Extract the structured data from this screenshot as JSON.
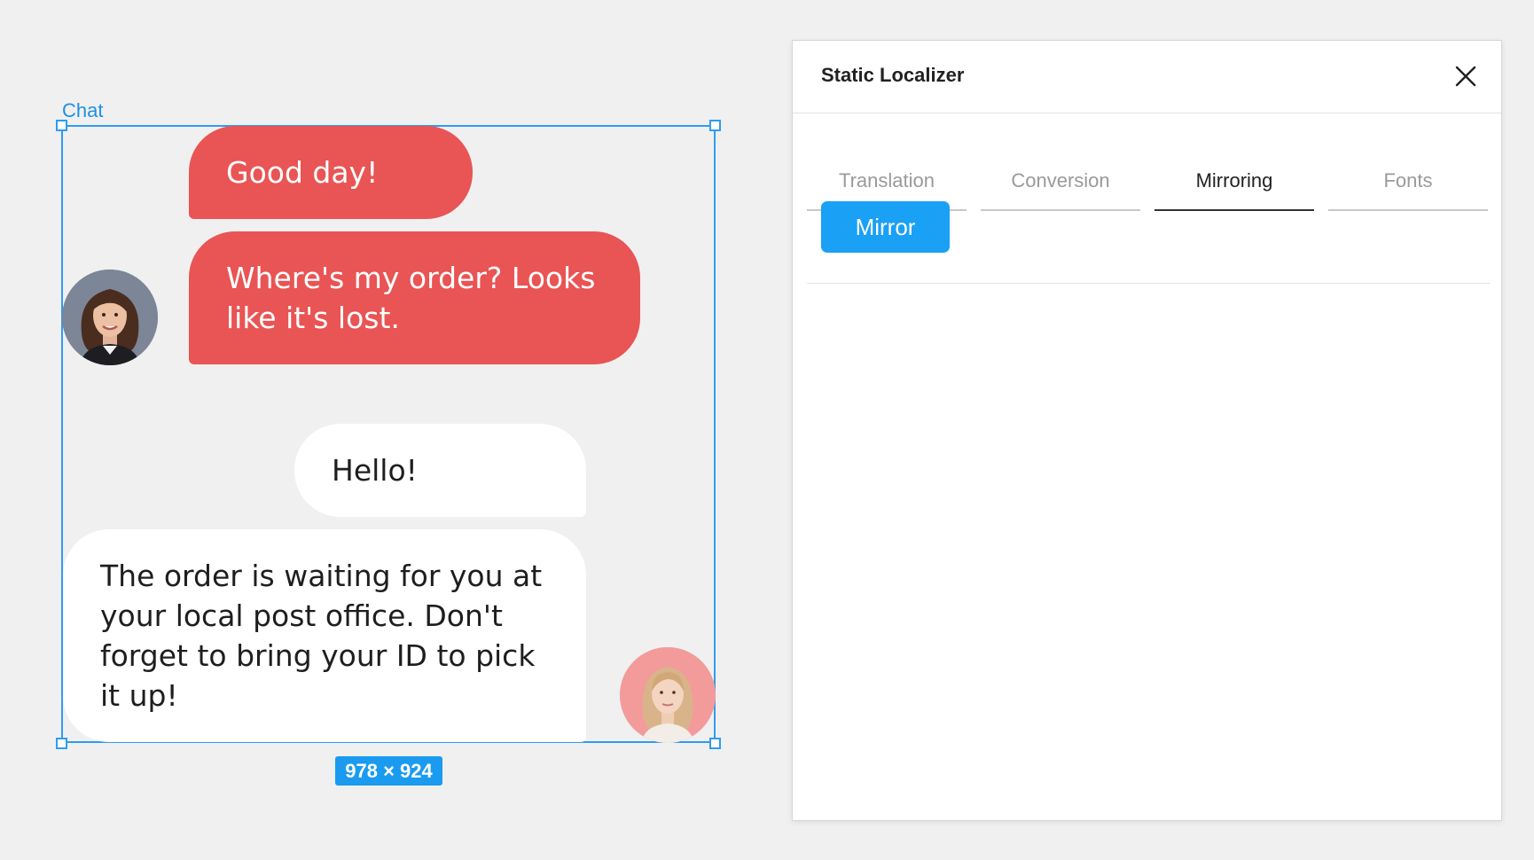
{
  "canvas": {
    "frame_label": "Chat",
    "dimensions_badge": "978 × 924"
  },
  "chat": {
    "messages": [
      {
        "text": "Good day!",
        "color": "#e95454"
      },
      {
        "text": "Where's my order? Looks like it's lost.",
        "color": "#e95454"
      },
      {
        "text": "Hello!",
        "color": "#ffffff"
      },
      {
        "text": "The order is waiting for you at your local post office. Don't forget to bring your ID to pick it up!",
        "color": "#ffffff"
      }
    ]
  },
  "panel": {
    "title": "Static Localizer",
    "tabs": [
      {
        "label": "Translation",
        "active": false
      },
      {
        "label": "Conversion",
        "active": false
      },
      {
        "label": "Mirroring",
        "active": true
      },
      {
        "label": "Fonts",
        "active": false
      }
    ],
    "mirror_button": "Mirror"
  },
  "colors": {
    "selection": "#2f9cf0",
    "primary_button": "#1aa0f4",
    "customer_bubble": "#e95454",
    "agent_bubble": "#ffffff"
  }
}
